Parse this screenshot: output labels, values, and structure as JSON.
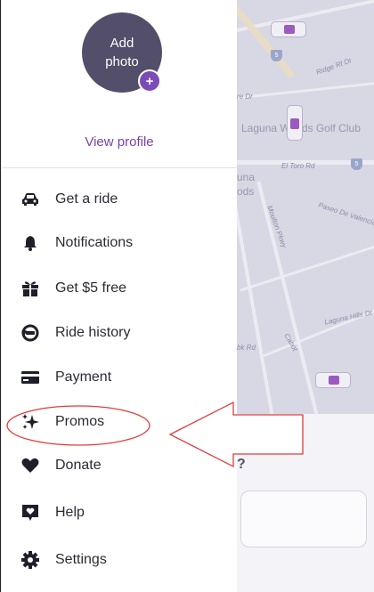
{
  "profile": {
    "add_photo_line1": "Add",
    "add_photo_line2": "photo",
    "plus": "+",
    "view_profile": "View profile"
  },
  "menu": {
    "items": [
      {
        "label": "Get a ride",
        "icon": "car-icon"
      },
      {
        "label": "Notifications",
        "icon": "bell-icon"
      },
      {
        "label": "Get $5 free",
        "icon": "gift-icon"
      },
      {
        "label": "Ride history",
        "icon": "history-icon"
      },
      {
        "label": "Payment",
        "icon": "credit-card-icon"
      },
      {
        "label": "Promos",
        "icon": "sparkle-icon"
      },
      {
        "label": "Donate",
        "icon": "heart-icon"
      },
      {
        "label": "Help",
        "icon": "help-chat-icon"
      },
      {
        "label": "Settings",
        "icon": "gear-icon"
      }
    ]
  },
  "map": {
    "labels": {
      "ridge": "Ridge Rt Dr",
      "laguna_woods": "Laguna Woods Golf Club",
      "el_toro": "El Toro Rd",
      "paseo": "Paseo De Valencia",
      "moulton": "Moulton Pkwy",
      "laguna_hills": "Laguna Hills Dr",
      "una": "una",
      "ods": "ods",
      "re_dr": "re Dr",
      "cabot": "Cabot",
      "bk_rd": "bk Rd",
      "shield": "5"
    }
  },
  "bottom_panel": {
    "question_fragment": "?"
  },
  "colors": {
    "accent_purple": "#7a3fb2",
    "avatar_bg": "#534e6a",
    "annotation_red": "#e23b3b"
  }
}
